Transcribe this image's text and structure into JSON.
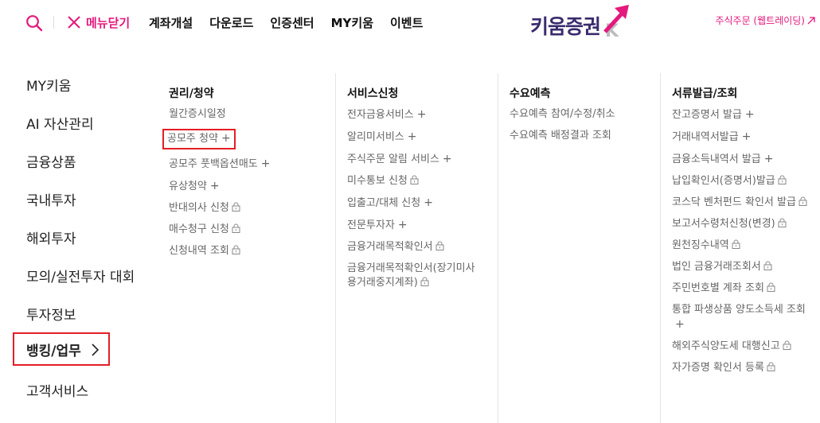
{
  "header": {
    "close_label": "메뉴닫기",
    "nav": [
      "계좌개설",
      "다운로드",
      "인증센터",
      "MY키움",
      "이벤트"
    ],
    "logo_text": "키움증권",
    "trade_link": "주식주문 (웹트레이딩)",
    "accent_color": "#e3197d"
  },
  "left_menu": [
    {
      "label": "MY키움"
    },
    {
      "label": "AI 자산관리"
    },
    {
      "label": "금융상품"
    },
    {
      "label": "국내투자"
    },
    {
      "label": "해외투자"
    },
    {
      "label": "모의/실전투자 대회"
    },
    {
      "label": "투자정보"
    },
    {
      "label": "뱅킹/업무",
      "active": true
    },
    {
      "label": "고객서비스"
    }
  ],
  "columns": [
    {
      "title": "권리/청약",
      "items": [
        {
          "label": "월간증시일정"
        },
        {
          "label": "공모주 청약",
          "icon": "plus",
          "highlighted": true
        },
        {
          "label": "공모주 풋백옵션매도",
          "icon": "plus"
        },
        {
          "label": "유상청약",
          "icon": "plus"
        },
        {
          "label": "반대의사 신청",
          "icon": "lock"
        },
        {
          "label": "매수청구 신청",
          "icon": "lock"
        },
        {
          "label": "신청내역 조회",
          "icon": "lock"
        }
      ]
    },
    {
      "title": "서비스신청",
      "items": [
        {
          "label": "전자금융서비스",
          "icon": "plus"
        },
        {
          "label": "알리미서비스",
          "icon": "plus"
        },
        {
          "label": "주식주문 알림 서비스",
          "icon": "plus"
        },
        {
          "label": "미수통보 신청",
          "icon": "lock"
        },
        {
          "label": "입출고/대체 신청",
          "icon": "plus"
        },
        {
          "label": "전문투자자",
          "icon": "plus"
        },
        {
          "label": "금융거래목적확인서",
          "icon": "lock"
        },
        {
          "label": "금융거래목적확인서(장기미사용거래중지계좌)",
          "icon": "lock",
          "wrap": true
        }
      ]
    },
    {
      "title": "수요예측",
      "items": [
        {
          "label": "수요예측 참여/수정/취소"
        },
        {
          "label": "수요예측 배정결과 조회"
        }
      ]
    },
    {
      "title": "서류발급/조회",
      "items": [
        {
          "label": "잔고증명서 발급",
          "icon": "plus"
        },
        {
          "label": "거래내역서발급",
          "icon": "plus"
        },
        {
          "label": "금융소득내역서 발급",
          "icon": "plus"
        },
        {
          "label": "납입확인서(증명서)발급",
          "icon": "lock"
        },
        {
          "label": "코스닥 벤처펀드 확인서 발급",
          "icon": "lock",
          "wrap": true
        },
        {
          "label": "보고서수령처신청(변경)",
          "icon": "lock"
        },
        {
          "label": "원천징수내역",
          "icon": "lock"
        },
        {
          "label": "법인 금융거래조회서",
          "icon": "lock"
        },
        {
          "label": "주민번호별 계좌 조회",
          "icon": "lock"
        },
        {
          "label": "통합 파생상품 양도소득세 조회",
          "icon": "plus",
          "wrap": true
        },
        {
          "label": "해외주식양도세 대행신고",
          "icon": "lock"
        },
        {
          "label": "자가증명 확인서 등록",
          "icon": "lock"
        }
      ]
    }
  ]
}
